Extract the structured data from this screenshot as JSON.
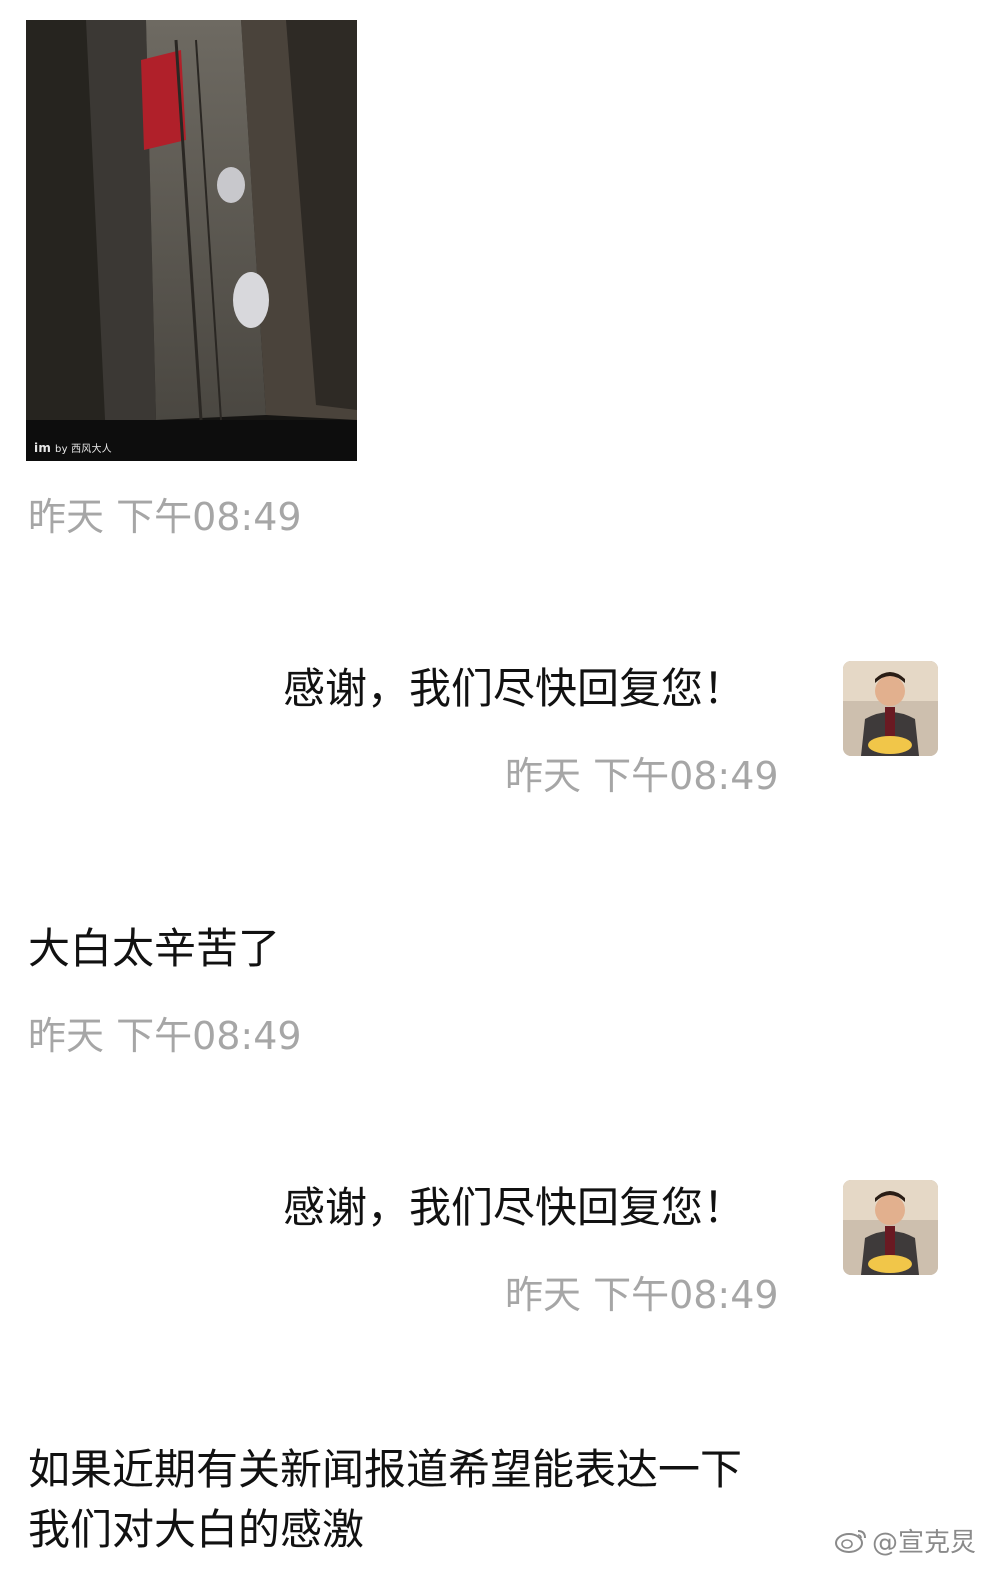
{
  "messages": [
    {
      "id": "m1",
      "side": "left",
      "kind": "image",
      "image_caption_logo": "im",
      "image_caption": "by 西风大人",
      "time": "昨天 下午08:49"
    },
    {
      "id": "m2",
      "side": "right",
      "kind": "text",
      "text": "感谢，我们尽快回复您！",
      "time": "昨天 下午08:49",
      "avatar_icon": "user-avatar"
    },
    {
      "id": "m3",
      "side": "left",
      "kind": "text",
      "text": "大白太辛苦了",
      "time": "昨天 下午08:49"
    },
    {
      "id": "m4",
      "side": "right",
      "kind": "text",
      "text": "感谢，我们尽快回复您！",
      "time": "昨天 下午08:49",
      "avatar_icon": "user-avatar"
    },
    {
      "id": "m5",
      "side": "left",
      "kind": "text",
      "lines": [
        "如果近期有关新闻报道希望能表达一下",
        "我们对大白的感激"
      ]
    }
  ],
  "watermark": {
    "text": "@宣克炅",
    "icon": "weibo-icon"
  },
  "colors": {
    "timestamp": "#a6a6a6",
    "text": "#111111",
    "background": "#ffffff"
  }
}
